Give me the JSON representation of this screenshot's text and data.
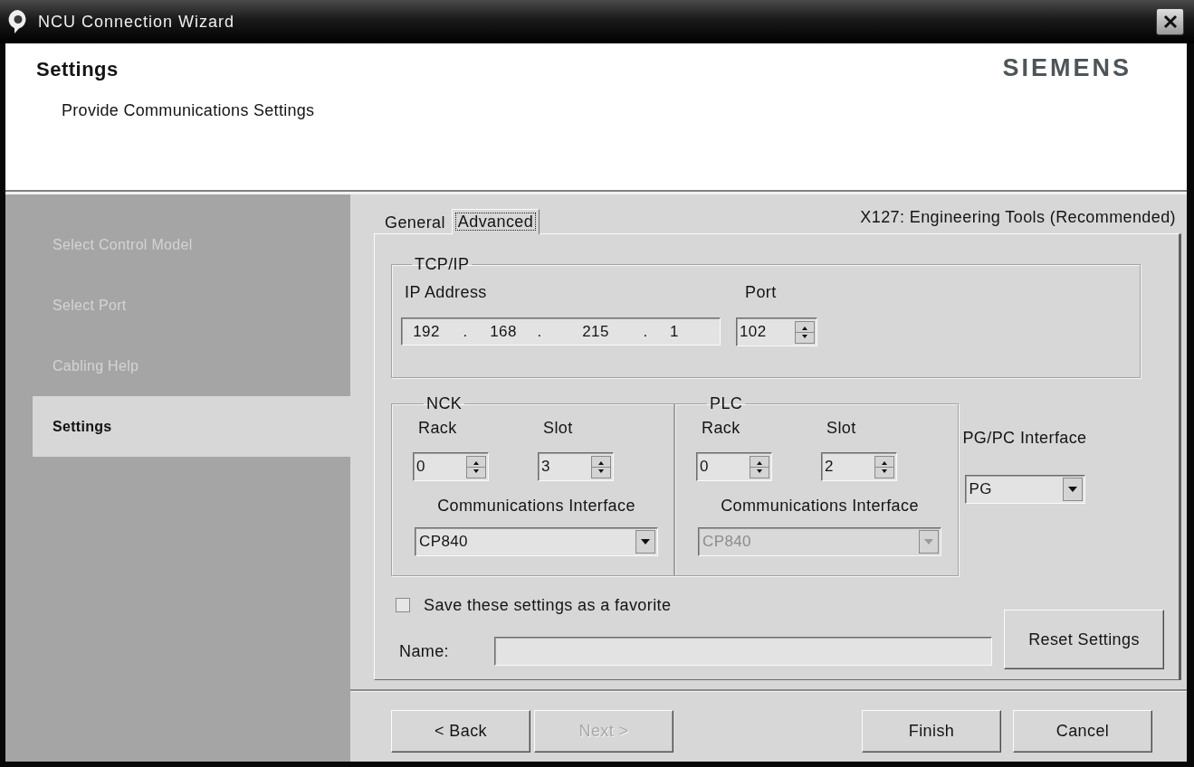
{
  "window": {
    "title": "NCU Connection Wizard"
  },
  "header": {
    "title": "Settings",
    "subtitle": "Provide Communications Settings",
    "logo": "SIEMENS"
  },
  "steps": [
    {
      "label": "Select Control Model",
      "selected": false
    },
    {
      "label": "Select Port",
      "selected": false
    },
    {
      "label": "Cabling Help",
      "selected": false
    },
    {
      "label": "Settings",
      "selected": true
    }
  ],
  "tabs": [
    {
      "label": "General",
      "selected": false
    },
    {
      "label": "Advanced",
      "selected": true
    }
  ],
  "connection": "X127: Engineering Tools (Recommended)",
  "tcpip": {
    "title": "TCP/IP",
    "ip_label": "IP Address",
    "ip_address": [
      "192",
      ".",
      "168",
      ".",
      "215",
      ".",
      "1"
    ],
    "port_label": "Port",
    "port": "102"
  },
  "controllers": [
    {
      "title": "NCK",
      "rack_label": "Rack",
      "rack": "0",
      "slot_label": "Slot",
      "slot": "3",
      "interface_label": "Communications Interface",
      "interface": {
        "value": "CP840",
        "disabled": false
      }
    },
    {
      "title": "PLC",
      "rack_label": "Rack",
      "rack": "0",
      "slot_label": "Slot",
      "slot": "2",
      "interface_label": "Communications Interface",
      "interface": {
        "value": "CP840",
        "disabled": true
      }
    }
  ],
  "pgpc_interface": {
    "label": "PG/PC Interface",
    "value": "PG"
  },
  "favorite": {
    "label": "Save these settings as a favorite",
    "checked": false
  },
  "name_field": {
    "label": "Name:"
  },
  "reset_button": "Reset Settings",
  "nav_buttons": [
    {
      "label": "< Back",
      "disabled": false
    },
    {
      "label": "Next >",
      "disabled": true
    }
  ],
  "action_buttons": [
    {
      "label": "Finish"
    },
    {
      "label": "Cancel"
    }
  ]
}
